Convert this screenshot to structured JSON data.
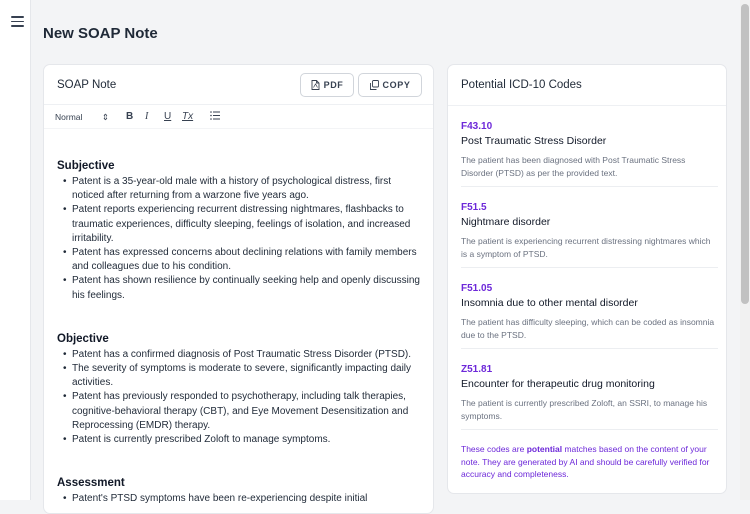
{
  "page": {
    "title": "New SOAP Note"
  },
  "note": {
    "title": "SOAP Note",
    "pdf_label": "PDF",
    "copy_label": "COPY",
    "toolbar": {
      "format": "Normal",
      "bold": "B",
      "italic": "I",
      "underline": "U",
      "clear": "Tx"
    },
    "sections": [
      {
        "heading": "Subjective",
        "bullets": [
          "Patent is a 35-year-old male with a history of psychological distress, first noticed after returning from a warzone five years ago.",
          "Patent reports experiencing recurrent distressing nightmares, flashbacks to traumatic experiences, difficulty sleeping, feelings of isolation, and increased irritability.",
          "Patent has expressed concerns about declining relations with family members and colleagues due to his condition.",
          "Patent has shown resilience by continually seeking help and openly discussing his feelings."
        ]
      },
      {
        "heading": "Objective",
        "bullets": [
          "Patent has a confirmed diagnosis of Post Traumatic Stress Disorder (PTSD).",
          "The severity of symptoms is moderate to severe, significantly impacting daily activities.",
          "Patent has previously responded to psychotherapy, including talk therapies, cognitive-behavioral therapy (CBT), and Eye Movement Desensitization and Reprocessing (EMDR) therapy.",
          "Patent is currently prescribed Zoloft to manage symptoms."
        ]
      },
      {
        "heading": "Assessment",
        "bullets": [
          "Patent's PTSD symptoms have been re-experiencing despite initial"
        ]
      }
    ]
  },
  "icd": {
    "title": "Potential ICD-10 Codes",
    "codes": [
      {
        "code": "F43.10",
        "name": "Post Traumatic Stress Disorder",
        "desc": "The patient has been diagnosed with Post Traumatic Stress Disorder (PTSD) as per the provided text."
      },
      {
        "code": "F51.5",
        "name": "Nightmare disorder",
        "desc": "The patient is experiencing recurrent distressing nightmares which is a symptom of PTSD."
      },
      {
        "code": "F51.05",
        "name": "Insomnia due to other mental disorder",
        "desc": "The patient has difficulty sleeping, which can be coded as insomnia due to the PTSD."
      },
      {
        "code": "Z51.81",
        "name": "Encounter for therapeutic drug monitoring",
        "desc": "The patient is currently prescribed Zoloft, an SSRI, to manage his symptoms."
      }
    ],
    "disclaimer_pre": "These codes are ",
    "disclaimer_strong": "potential",
    "disclaimer_post": " matches based on the content of your note. They are generated by AI and should be carefully verified for accuracy and completeness."
  }
}
